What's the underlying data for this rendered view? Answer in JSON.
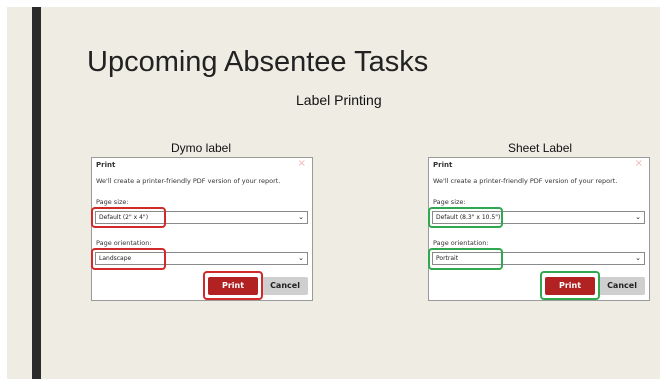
{
  "slide": {
    "title": "Upcoming Absentee Tasks",
    "subtitle": "Label Printing"
  },
  "panels": {
    "left": {
      "heading": "Dymo label",
      "highlight_color": "#d12a2a",
      "dialog": {
        "title": "Print",
        "close_icon": "×",
        "description": "We'll create a printer-friendly PDF version of your report.",
        "page_size_label": "Page size:",
        "page_size_value": "Default (2\" x 4\")",
        "orientation_label": "Page orientation:",
        "orientation_value": "Landscape",
        "print_label": "Print",
        "cancel_label": "Cancel"
      }
    },
    "right": {
      "heading": "Sheet Label",
      "highlight_color": "#2fa84f",
      "dialog": {
        "title": "Print",
        "close_icon": "×",
        "description": "We'll create a printer-friendly PDF version of your report.",
        "page_size_label": "Page size:",
        "page_size_value": "Default (8.3\" x 10.5\")",
        "orientation_label": "Page orientation:",
        "orientation_value": "Portrait",
        "print_label": "Print",
        "cancel_label": "Cancel"
      }
    }
  },
  "colors": {
    "background": "#efece3",
    "accent_bar": "#2b2b2b",
    "print_button": "#b22222",
    "cancel_button": "#cfcfcf"
  }
}
